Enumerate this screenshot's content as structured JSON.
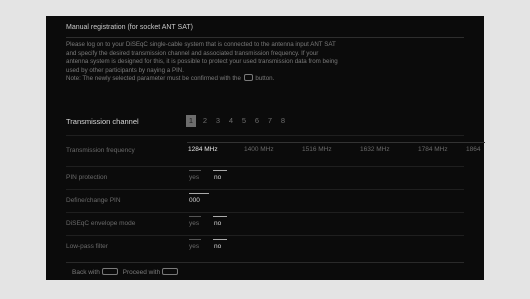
{
  "screen": {
    "title": "Manual registration (for socket ANT SAT)",
    "description_lines": [
      "Please log on to your DiSEqC single-cable system that is connected to the antenna input ANT SAT",
      "and specify the desired transmission channel and associated transmission frequency. If your",
      "antenna system is designed for this, it is possible to protect your used transmission data from being",
      "used by other participants by naying a PIN."
    ],
    "note_prefix": "Note: The newly selected parameter must be confirmed with the",
    "note_suffix": "button."
  },
  "rows": {
    "channel_label": "Transmission channel",
    "channels": [
      "1",
      "2",
      "3",
      "4",
      "5",
      "6",
      "7",
      "8"
    ],
    "selected_channel": "1",
    "frequency_label": "Transmission frequency",
    "frequencies": [
      "1284 MHz",
      "1400 MHz",
      "1516 MHz",
      "1632 MHz",
      "1784 MHz",
      "1864"
    ],
    "selected_frequency": "1284 MHz",
    "pin_protection_label": "PIN protection",
    "pin_protection_yes": "yes",
    "pin_protection_no": "no",
    "define_pin_label": "Define/change PIN",
    "pin_value": "000",
    "envelope_label": "DiSEqC envelope mode",
    "envelope_yes": "yes",
    "envelope_no": "no",
    "lowpass_label": "Low-pass filter",
    "lowpass_yes": "yes",
    "lowpass_no": "no"
  },
  "footer": {
    "back_label": "Back with",
    "proceed_label": "Proceed with"
  }
}
